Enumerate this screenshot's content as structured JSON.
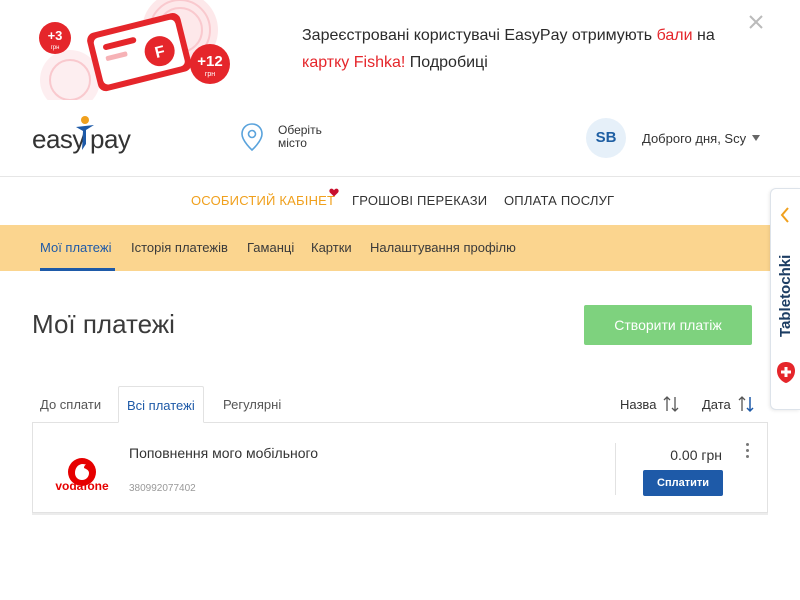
{
  "promo": {
    "badge_small": "+3",
    "badge_small_unit": "грн",
    "badge_large": "+12",
    "badge_large_unit": "грн",
    "card_letter": "F",
    "text_1": "Зареєстровані користувачі EasyPay отримують ",
    "link_1": "бали",
    "text_2": " на ",
    "link_2": "картку Fishka!",
    "text_3": " Подробиці",
    "close_icon": "close-icon"
  },
  "header": {
    "logo_text": "easypay",
    "city_label": "Оберіть місто",
    "avatar_initials": "SB",
    "greeting": "Доброго дня, Scy"
  },
  "main_nav": {
    "items": [
      {
        "label": "ОСОБИСТИЙ КАБІНЕТ",
        "active": true
      },
      {
        "label": "ГРОШОВІ ПЕРЕКАЗИ",
        "active": false
      },
      {
        "label": "ОПЛАТА ПОСЛУГ",
        "active": false
      }
    ]
  },
  "sub_nav": {
    "items": [
      {
        "label": "Мої платежі",
        "active": true
      },
      {
        "label": "Історія платежів",
        "active": false
      },
      {
        "label": "Гаманці",
        "active": false
      },
      {
        "label": "Картки",
        "active": false
      },
      {
        "label": "Налаштування профілю",
        "active": false
      }
    ]
  },
  "page": {
    "title": "Мої платежі",
    "create_button": "Створити платіж"
  },
  "tabs": {
    "items": [
      {
        "label": "До сплати",
        "active": false
      },
      {
        "label": "Всі платежі",
        "active": true
      },
      {
        "label": "Регулярні",
        "active": false
      }
    ],
    "sort_name": "Назва",
    "sort_date": "Дата"
  },
  "payments": [
    {
      "provider": "vodafone",
      "name": "Поповнення мого мобільного",
      "account": "380992077402",
      "amount": "0.00 грн",
      "pay_button": "Сплатити"
    }
  ],
  "side_widget": {
    "label": "Tabletochki"
  },
  "colors": {
    "brand_blue": "#1e5aa8",
    "accent_orange": "#f0a01d",
    "subnav_bg": "#fbd58f",
    "create_green": "#7ed27e",
    "promo_red": "#e5262b",
    "vodafone_red": "#e60000"
  }
}
